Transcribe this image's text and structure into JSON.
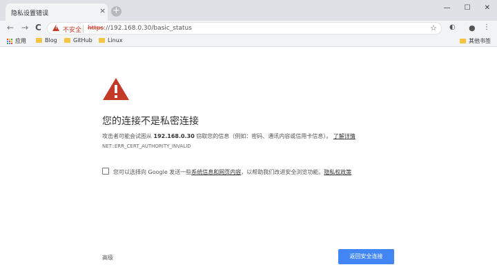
{
  "browser": {
    "tab_title": "隐私设置错误",
    "tab_close": "×",
    "new_tab": "+",
    "window_controls": [
      "—",
      "☐",
      "✕"
    ],
    "nav": {
      "back": "←",
      "forward": "→",
      "reload": "C"
    },
    "omnibox": {
      "security_label": "不安全",
      "url_scheme": "https",
      "url_rest": "://192.168.0.30/basic_status"
    },
    "bookmarks": [
      {
        "label": "应用",
        "icon": "apps-grid-icon"
      },
      {
        "label": "Blog",
        "icon": "folder-icon"
      },
      {
        "label": "GitHub",
        "icon": "folder-icon"
      },
      {
        "label": "Linux",
        "icon": "folder-icon"
      }
    ],
    "other_bookmarks": "其他书签"
  },
  "page": {
    "heading": "您的连接不是私密连接",
    "desc_prefix": "攻击者可能会试图从",
    "desc_host": "192.168.0.30",
    "desc_suffix": "窃取您的信息（例如：密码、通讯内容或信用卡信息）。",
    "learn_more": "了解详情",
    "error_code": "NET::ERR_CERT_AUTHORITY_INVALID",
    "report_prefix": "您可以选择向 Google 发送一些",
    "report_link": "系统信息和网页内容",
    "report_middle": "，以帮助我们改进安全浏览功能。",
    "privacy_link": "隐私权政策",
    "advanced": "高级",
    "back_to_safety": "返回安全连接"
  },
  "colors": {
    "warning_red": "#c53929",
    "button_blue": "#4285f4",
    "folder_yellow": "#f4c542",
    "apps_grid": [
      "#ea4335",
      "#fbbc05",
      "#34a853",
      "#4285f4",
      "#ea4335",
      "#fbbc05",
      "#34a853",
      "#4285f4",
      "#ea4335"
    ]
  }
}
